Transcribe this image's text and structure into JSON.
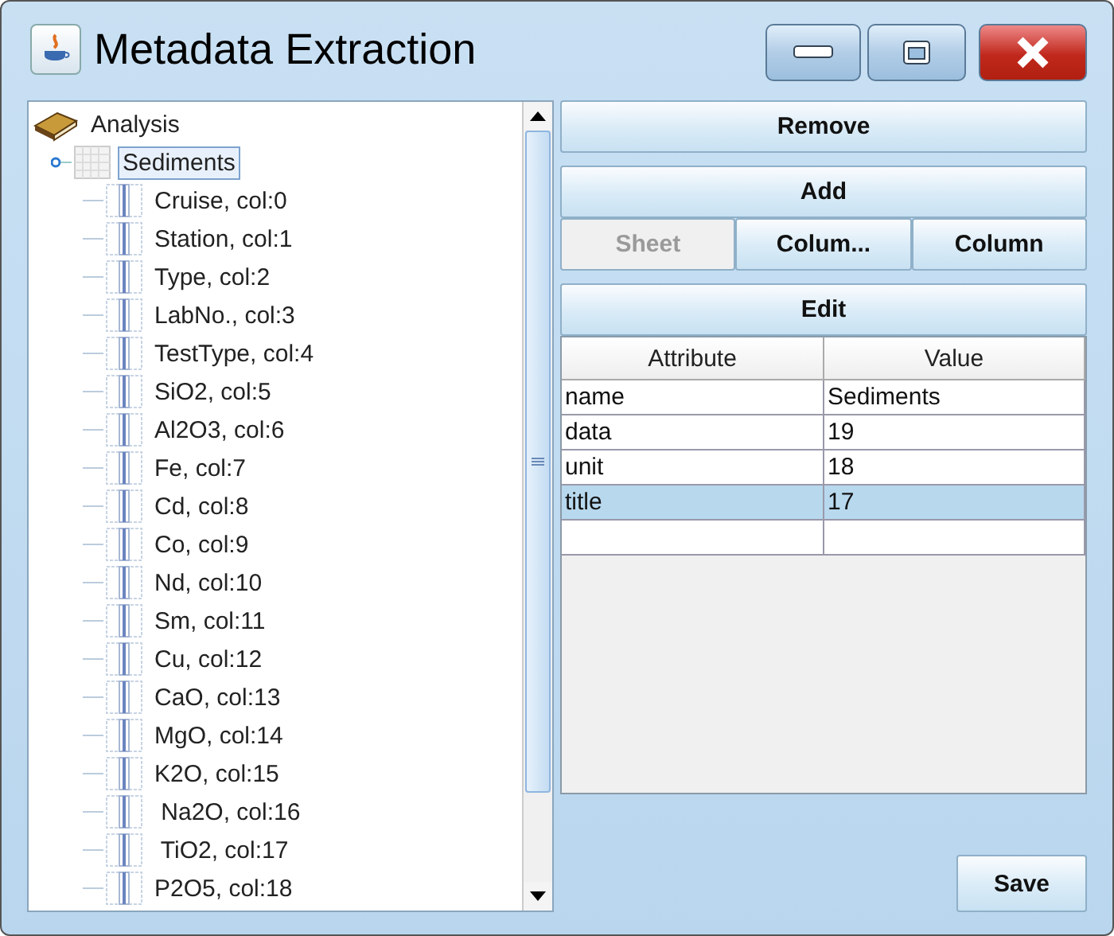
{
  "window": {
    "title": "Metadata Extraction"
  },
  "tree": [
    {
      "label": "Analysis",
      "kind": "project",
      "selected": false,
      "children": [
        {
          "label": "Sediments",
          "kind": "sheet",
          "selected": true,
          "children": [
            {
              "label": "Cruise, col:0",
              "kind": "column",
              "selected": false
            },
            {
              "label": "Station, col:1",
              "kind": "column",
              "selected": false
            },
            {
              "label": "Type, col:2",
              "kind": "column",
              "selected": false
            },
            {
              "label": "LabNo., col:3",
              "kind": "column",
              "selected": false
            },
            {
              "label": "TestType, col:4",
              "kind": "column",
              "selected": false
            },
            {
              "label": "SiO2, col:5",
              "kind": "column",
              "selected": false
            },
            {
              "label": "Al2O3, col:6",
              "kind": "column",
              "selected": false
            },
            {
              "label": "Fe, col:7",
              "kind": "column",
              "selected": false
            },
            {
              "label": "Cd, col:8",
              "kind": "column",
              "selected": false
            },
            {
              "label": "Co, col:9",
              "kind": "column",
              "selected": false
            },
            {
              "label": "Nd, col:10",
              "kind": "column",
              "selected": false
            },
            {
              "label": "Sm, col:11",
              "kind": "column",
              "selected": false
            },
            {
              "label": "Cu, col:12",
              "kind": "column",
              "selected": false
            },
            {
              "label": "CaO, col:13",
              "kind": "column",
              "selected": false
            },
            {
              "label": "MgO, col:14",
              "kind": "column",
              "selected": false
            },
            {
              "label": "K2O, col:15",
              "kind": "column",
              "selected": false
            },
            {
              "label": " Na2O, col:16",
              "kind": "column",
              "selected": false
            },
            {
              "label": " TiO2, col:17",
              "kind": "column",
              "selected": false
            },
            {
              "label": "P2O5, col:18",
              "kind": "column",
              "selected": false
            }
          ]
        }
      ]
    }
  ],
  "buttons": {
    "remove": "Remove",
    "add": "Add",
    "row": [
      {
        "label": "Sheet",
        "disabled": true
      },
      {
        "label": "Colum...",
        "disabled": false
      },
      {
        "label": "Column",
        "disabled": false
      }
    ],
    "edit": "Edit",
    "save": "Save"
  },
  "table": {
    "columns": [
      "Attribute",
      "Value"
    ],
    "rows": [
      {
        "cells": [
          "name",
          "Sediments"
        ],
        "selected": false
      },
      {
        "cells": [
          "data",
          "19"
        ],
        "selected": false
      },
      {
        "cells": [
          "unit",
          "18"
        ],
        "selected": false
      },
      {
        "cells": [
          "title",
          "17"
        ],
        "selected": true
      },
      {
        "cells": [
          "",
          ""
        ],
        "selected": false
      }
    ]
  }
}
